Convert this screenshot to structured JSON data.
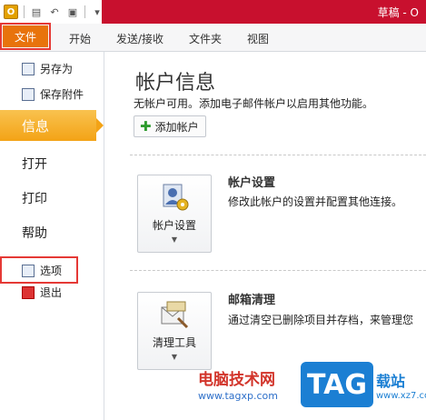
{
  "titlebar": {
    "title": "草稿 - O"
  },
  "ribbon": {
    "file_tab": "文件",
    "tabs": [
      "开始",
      "发送/接收",
      "文件夹",
      "视图"
    ]
  },
  "nav": {
    "save_as": "另存为",
    "save_attachments": "保存附件",
    "info": "信息",
    "open": "打开",
    "print": "打印",
    "help": "帮助",
    "options": "选项",
    "exit": "退出"
  },
  "main": {
    "title": "帐户信息",
    "description": "无帐户可用。添加电子邮件帐户以启用其他功能。",
    "add_account_button": "添加帐户",
    "account_settings": {
      "tile_label": "帐户设置",
      "title": "帐户设置",
      "description": "修改此帐户的设置并配置其他连接。"
    },
    "mailbox_cleanup": {
      "tile_label": "清理工具",
      "title": "邮箱清理",
      "description": "通过清空已删除项目并存档，来管理您"
    }
  },
  "watermark": {
    "site_name": "电脑技术网",
    "url": "www.tagxp.com",
    "tag": "TAG",
    "tag_site": "载站",
    "tag_url": "www.xz7.com"
  },
  "colors": {
    "file_tab": "#e8730c",
    "title_bar": "#c8102e",
    "nav_active": "#f3a316",
    "highlight_box": "#e53935"
  }
}
